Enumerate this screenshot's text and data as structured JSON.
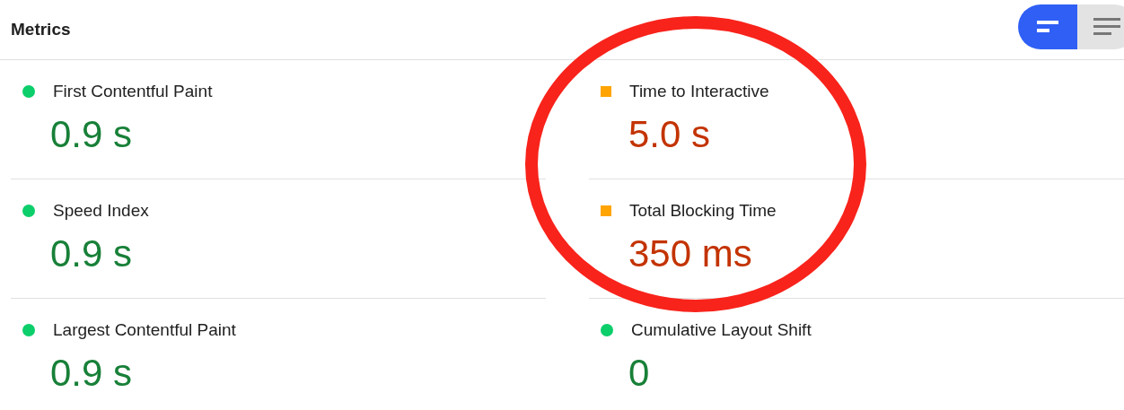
{
  "header": {
    "title": "Metrics"
  },
  "view_toggle": [
    {
      "kind": "summary",
      "selected": true
    },
    {
      "kind": "list",
      "selected": false
    }
  ],
  "metrics": [
    {
      "label": "First Contentful Paint",
      "value": "0.9 s",
      "kind": "pass",
      "color": "#0cce6b"
    },
    {
      "label": "Time to Interactive",
      "value": "5.0 s",
      "kind": "average",
      "color": "#ffa400"
    },
    {
      "label": "Speed Index",
      "value": "0.9 s",
      "kind": "pass",
      "color": "#0cce6b"
    },
    {
      "label": "Total Blocking Time",
      "value": "350 ms",
      "kind": "average",
      "color": "#ffa400"
    },
    {
      "label": "Largest Contentful Paint",
      "value": "0.9 s",
      "kind": "pass",
      "color": "#0cce6b"
    },
    {
      "label": "Cumulative Layout Shift",
      "value": "0",
      "kind": "pass",
      "color": "#0cce6b"
    }
  ],
  "annotation": {
    "kind": "circle"
  }
}
